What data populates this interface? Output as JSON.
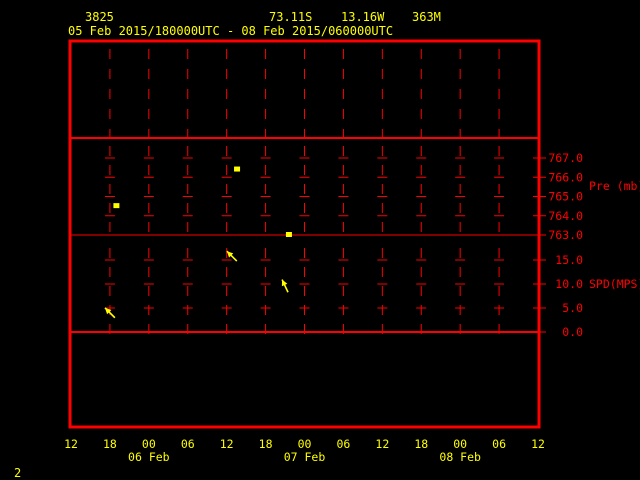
{
  "header": {
    "station": "3825",
    "lat": "73.11S",
    "lon": "13.16W",
    "elev": "363M",
    "range": "05 Feb 2015/180000UTC - 08 Feb 2015/060000UTC"
  },
  "footer": {
    "page": "2"
  },
  "colors": {
    "frame": "#ff0000",
    "text": "#ffff00",
    "data": "#ffff00"
  },
  "chart_data": {
    "type": "scatter",
    "title": "05 Feb 2015/180000UTC - 08 Feb 2015/060000UTC",
    "x_hours_range": [
      0,
      72
    ],
    "x_ticks": [
      "12",
      "18",
      "00",
      "06",
      "12",
      "18",
      "00",
      "06",
      "12",
      "18",
      "00",
      "06",
      "12"
    ],
    "x_dates": [
      "06 Feb",
      "07 Feb",
      "08 Feb"
    ],
    "panels": [
      {
        "name": "pressure",
        "ylabel": "Pre (mb)",
        "ylim": [
          763.0,
          767.0
        ],
        "yticks": [
          "767.0",
          "766.0",
          "765.0",
          "764.0",
          "763.0"
        ],
        "points": [
          {
            "hours": 7,
            "value": 764.5
          },
          {
            "hours": 25.6,
            "value": 766.4
          },
          {
            "hours": 33.6,
            "value": 763.0
          }
        ]
      },
      {
        "name": "wind",
        "ylabel": "SPD(MPS)",
        "ylim": [
          0.0,
          15.0
        ],
        "yticks": [
          "15.0",
          "10.0",
          "5.0",
          "0.0"
        ],
        "points": [
          {
            "hours": 6,
            "value": 4.0,
            "direction": "NW"
          },
          {
            "hours": 24.8,
            "value": 15.8,
            "direction": "NW"
          },
          {
            "hours": 33,
            "value": 9.6,
            "direction": "NNW"
          }
        ]
      }
    ]
  }
}
